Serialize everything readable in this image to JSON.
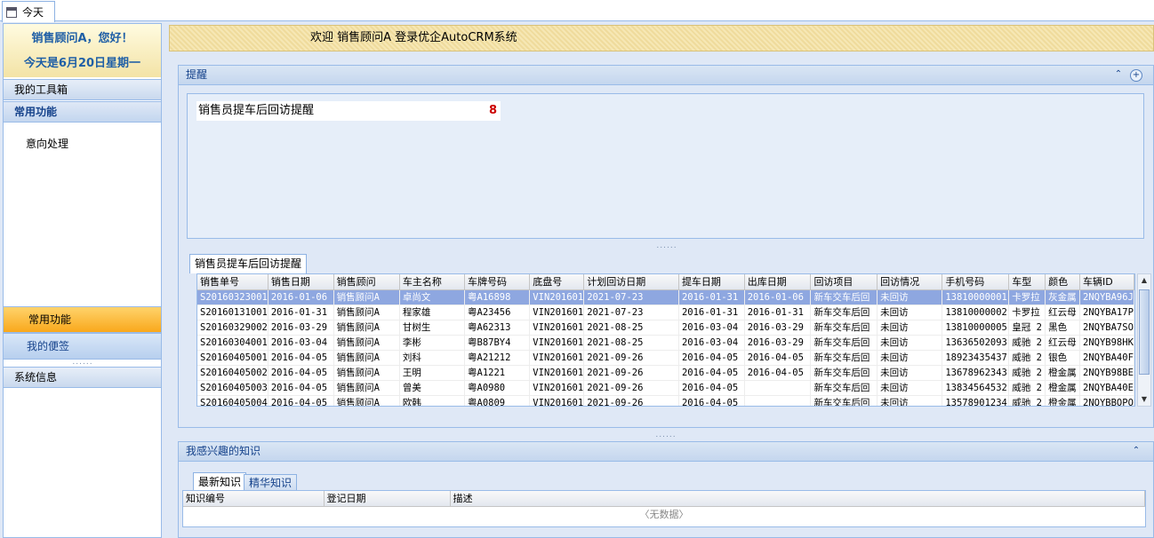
{
  "tabbar": {
    "tab_today": "今天"
  },
  "sidebar": {
    "greeting_line1": "销售顾问A，您好！",
    "greeting_line2": "今天是6月20日星期一",
    "toolbox": "我的工具箱",
    "common_functions": "常用功能",
    "intent_processing": "意向处理",
    "bottom_common": "常用功能",
    "bottom_notes": "我的便签",
    "system_info": "系统信息"
  },
  "banner": {
    "welcome": "欢迎 销售顾问A 登录优企AutoCRM系统"
  },
  "reminder": {
    "title": "提醒",
    "item_label": "销售员提车后回访提醒",
    "item_count": "8",
    "splitter": "......",
    "subtab": "销售员提车后回访提醒",
    "columns": [
      "销售单号",
      "销售日期",
      "销售顾问",
      "车主名称",
      "车牌号码",
      "底盘号",
      "计划回访日期",
      "提车日期",
      "出库日期",
      "回访项目",
      "回访情况",
      "手机号码",
      "车型",
      "颜色",
      "车辆ID"
    ],
    "rows": [
      [
        "S20160323001",
        "2016-01-06",
        "销售顾问A",
        "卓尚文",
        "粤A16898",
        "VIN201601",
        "2021-07-23",
        "2016-01-31",
        "2016-01-06",
        "新车交车后回",
        "未回访",
        "13810000001",
        "卡罗拉",
        "灰金属",
        "2NQYBA96J"
      ],
      [
        "S20160131001",
        "2016-01-31",
        "销售顾问A",
        "程家雄",
        "粤A23456",
        "VIN201601",
        "2021-07-23",
        "2016-01-31",
        "2016-01-31",
        "新车交车后回",
        "未回访",
        "13810000002",
        "卡罗拉",
        "红云母",
        "2NQYBA17P"
      ],
      [
        "S20160329002",
        "2016-03-29",
        "销售顾问A",
        "甘树生",
        "粤A62313",
        "VIN201601",
        "2021-08-25",
        "2016-03-04",
        "2016-03-29",
        "新车交车后回",
        "未回访",
        "13810000005",
        "皇冠 2",
        "黑色",
        "2NQYBA7SO"
      ],
      [
        "S20160304001",
        "2016-03-04",
        "销售顾问A",
        "李彬",
        "粤B87BY4",
        "VIN201601",
        "2021-08-25",
        "2016-03-04",
        "2016-03-29",
        "新车交车后回",
        "未回访",
        "13636502093",
        "威驰 2",
        "红云母",
        "2NQYB98HK"
      ],
      [
        "S20160405001",
        "2016-04-05",
        "销售顾问A",
        "刘科",
        "粤A21212",
        "VIN201601",
        "2021-09-26",
        "2016-04-05",
        "2016-04-05",
        "新车交车后回",
        "未回访",
        "18923435437",
        "威驰 2",
        "银色",
        "2NQYBA40F"
      ],
      [
        "S20160405002",
        "2016-04-05",
        "销售顾问A",
        "王明",
        "粤A1221",
        "VIN201601",
        "2021-09-26",
        "2016-04-05",
        "2016-04-05",
        "新车交车后回",
        "未回访",
        "13678962343",
        "威驰 2",
        "橙金属",
        "2NQYB98BE"
      ],
      [
        "S20160405003",
        "2016-04-05",
        "销售顾问A",
        "曾美",
        "粤A0980",
        "VIN201601",
        "2021-09-26",
        "2016-04-05",
        "",
        "新车交车后回",
        "未回访",
        "13834564532",
        "威驰 2",
        "橙金属",
        "2NQYBA40E"
      ],
      [
        "S20160405004",
        "2016-04-05",
        "销售顾问A",
        "欧韩",
        "粤A0809",
        "VIN201601",
        "2021-09-26",
        "2016-04-05",
        "",
        "新车交车后回",
        "未回访",
        "13578901234",
        "威驰 2",
        "橙金属",
        "2NQYBBOPO"
      ]
    ]
  },
  "knowledge": {
    "title": "我感兴趣的知识",
    "tab_latest": "最新知识",
    "tab_featured": "精华知识",
    "columns": [
      "知识编号",
      "登记日期",
      "描述"
    ],
    "no_data": "〈无数据〉"
  },
  "colors": {
    "accent": "#15428b",
    "selected_row": "#8ea7e0",
    "count": "#cc0000"
  }
}
